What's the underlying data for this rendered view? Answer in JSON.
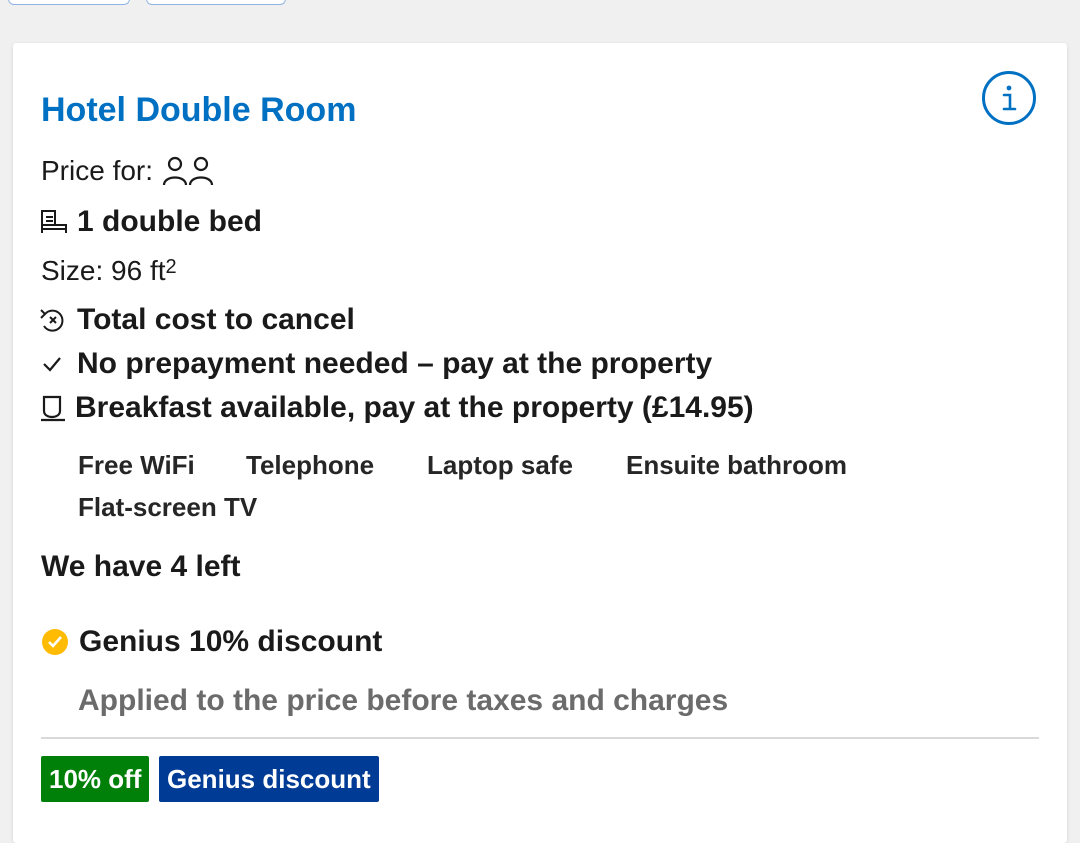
{
  "room": {
    "title": "Hotel Double Room",
    "price_for_label": "Price for:",
    "bed": "1 double bed",
    "size_label": "Size: 96 ft",
    "size_sup": "2",
    "cancel": "Total cost to cancel",
    "prepay_bold": "No prepayment needed",
    "prepay_rest": " – pay at the property",
    "breakfast": "Breakfast available, pay at the property (£14.95)",
    "facilities": [
      "Free WiFi",
      "Telephone",
      "Laptop safe",
      "Ensuite bathroom",
      "Flat-screen TV"
    ],
    "availability": "We have 4 left",
    "genius_title": "Genius 10% discount",
    "genius_note": "Applied to the price before taxes and charges"
  },
  "badges": {
    "off": "10% off",
    "genius": "Genius discount"
  },
  "colors": {
    "title_blue": "#0071c2",
    "badge_green": "#008009",
    "badge_navy": "#003b95",
    "genius_yellow": "#febb02"
  },
  "icons": [
    "info-icon",
    "two-guests-icon",
    "bed-icon",
    "cancel-clock-icon",
    "check-icon",
    "coffee-cup-icon",
    "genius-check-icon"
  ]
}
